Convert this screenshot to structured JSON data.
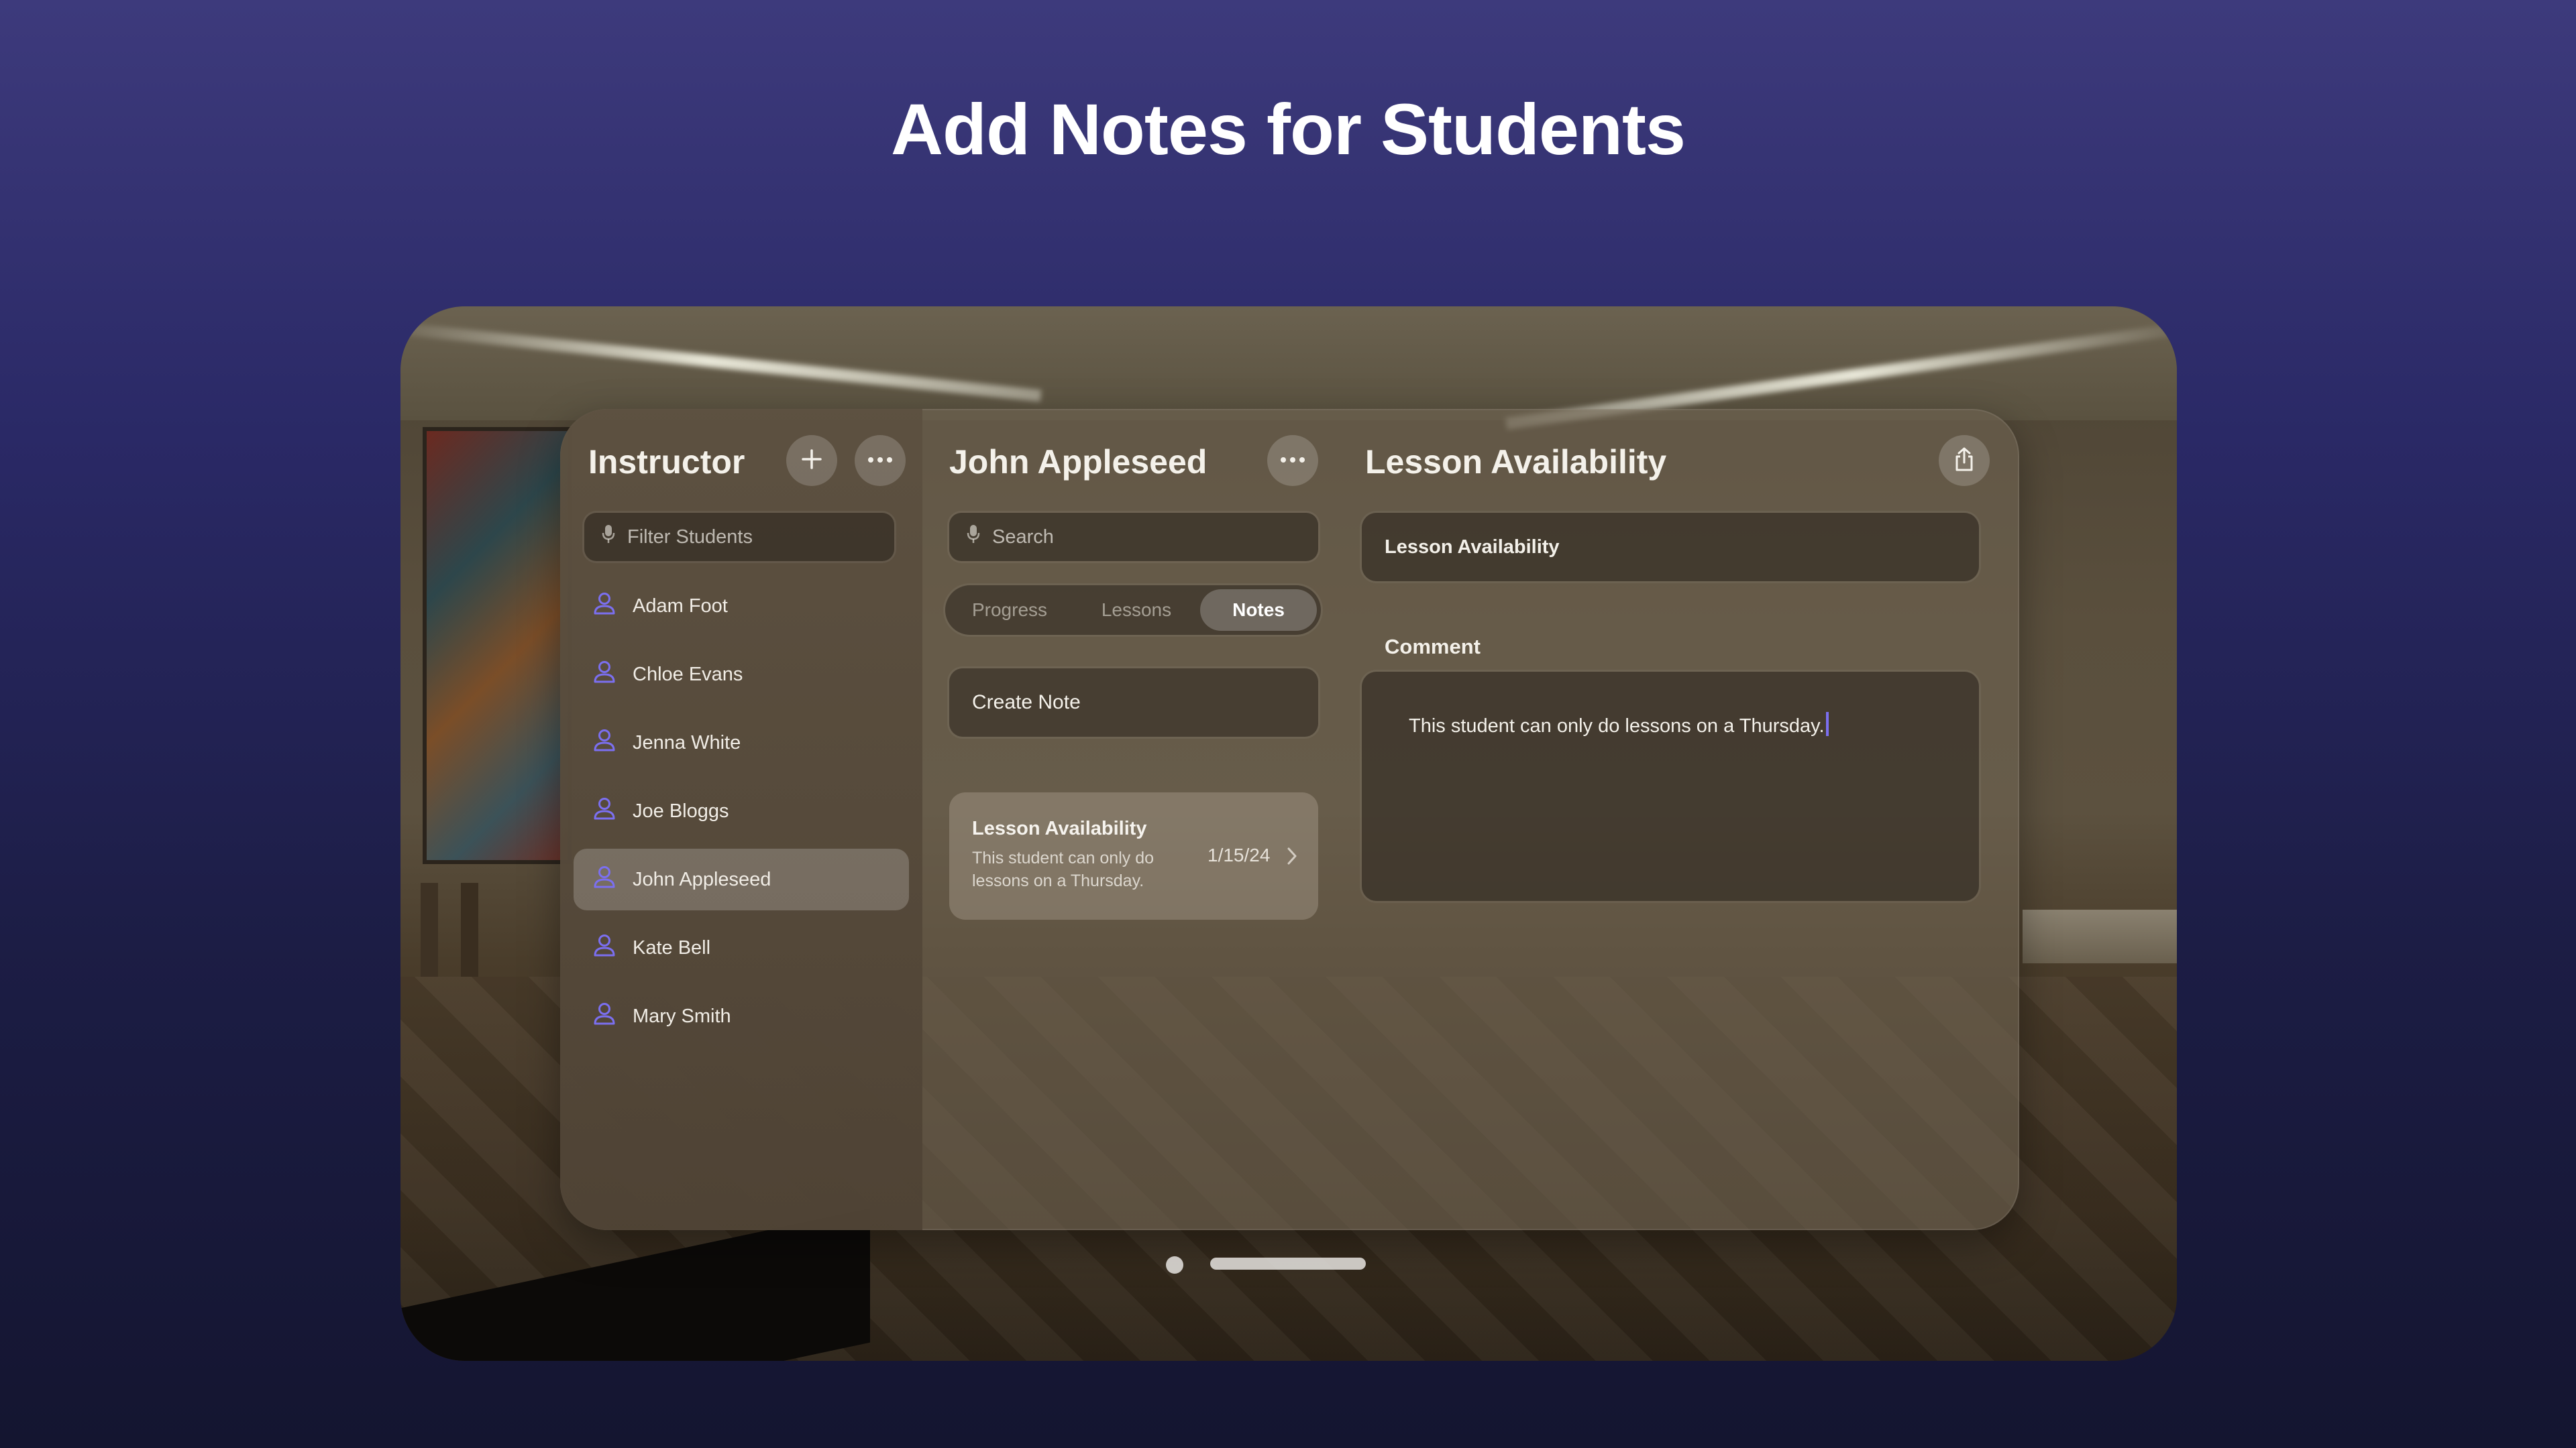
{
  "headline": "Add Notes for Students",
  "sidebar": {
    "title": "Instructor",
    "add_icon": "plus-icon",
    "more_icon": "ellipsis-icon",
    "filter_placeholder": "Filter Students",
    "students": [
      {
        "name": "Adam Foot",
        "selected": false
      },
      {
        "name": "Chloe Evans",
        "selected": false
      },
      {
        "name": "Jenna White",
        "selected": false
      },
      {
        "name": "Joe Bloggs",
        "selected": false
      },
      {
        "name": "John Appleseed",
        "selected": true
      },
      {
        "name": "Kate Bell",
        "selected": false
      },
      {
        "name": "Mary Smith",
        "selected": false
      }
    ]
  },
  "middle": {
    "title": "John Appleseed",
    "search_placeholder": "Search",
    "tabs": [
      {
        "label": "Progress",
        "active": false
      },
      {
        "label": "Lessons",
        "active": false
      },
      {
        "label": "Notes",
        "active": true
      }
    ],
    "create_note_label": "Create Note",
    "notes": [
      {
        "title": "Lesson Availability",
        "body_line1": "This student can only do",
        "body_line2": "lessons on a Thursday.",
        "date": "1/15/24"
      }
    ]
  },
  "detail": {
    "title": "Lesson Availability",
    "share_icon": "share-icon",
    "title_field_value": "Lesson Availability",
    "comment_label": "Comment",
    "comment_value": "This student can only do lessons on a Thursday."
  },
  "colors": {
    "background_top": "#3d3a7c",
    "background_bottom": "#141530",
    "accent_person_icon": "#7b6ff0",
    "text_primary": "#f4f1ea"
  }
}
